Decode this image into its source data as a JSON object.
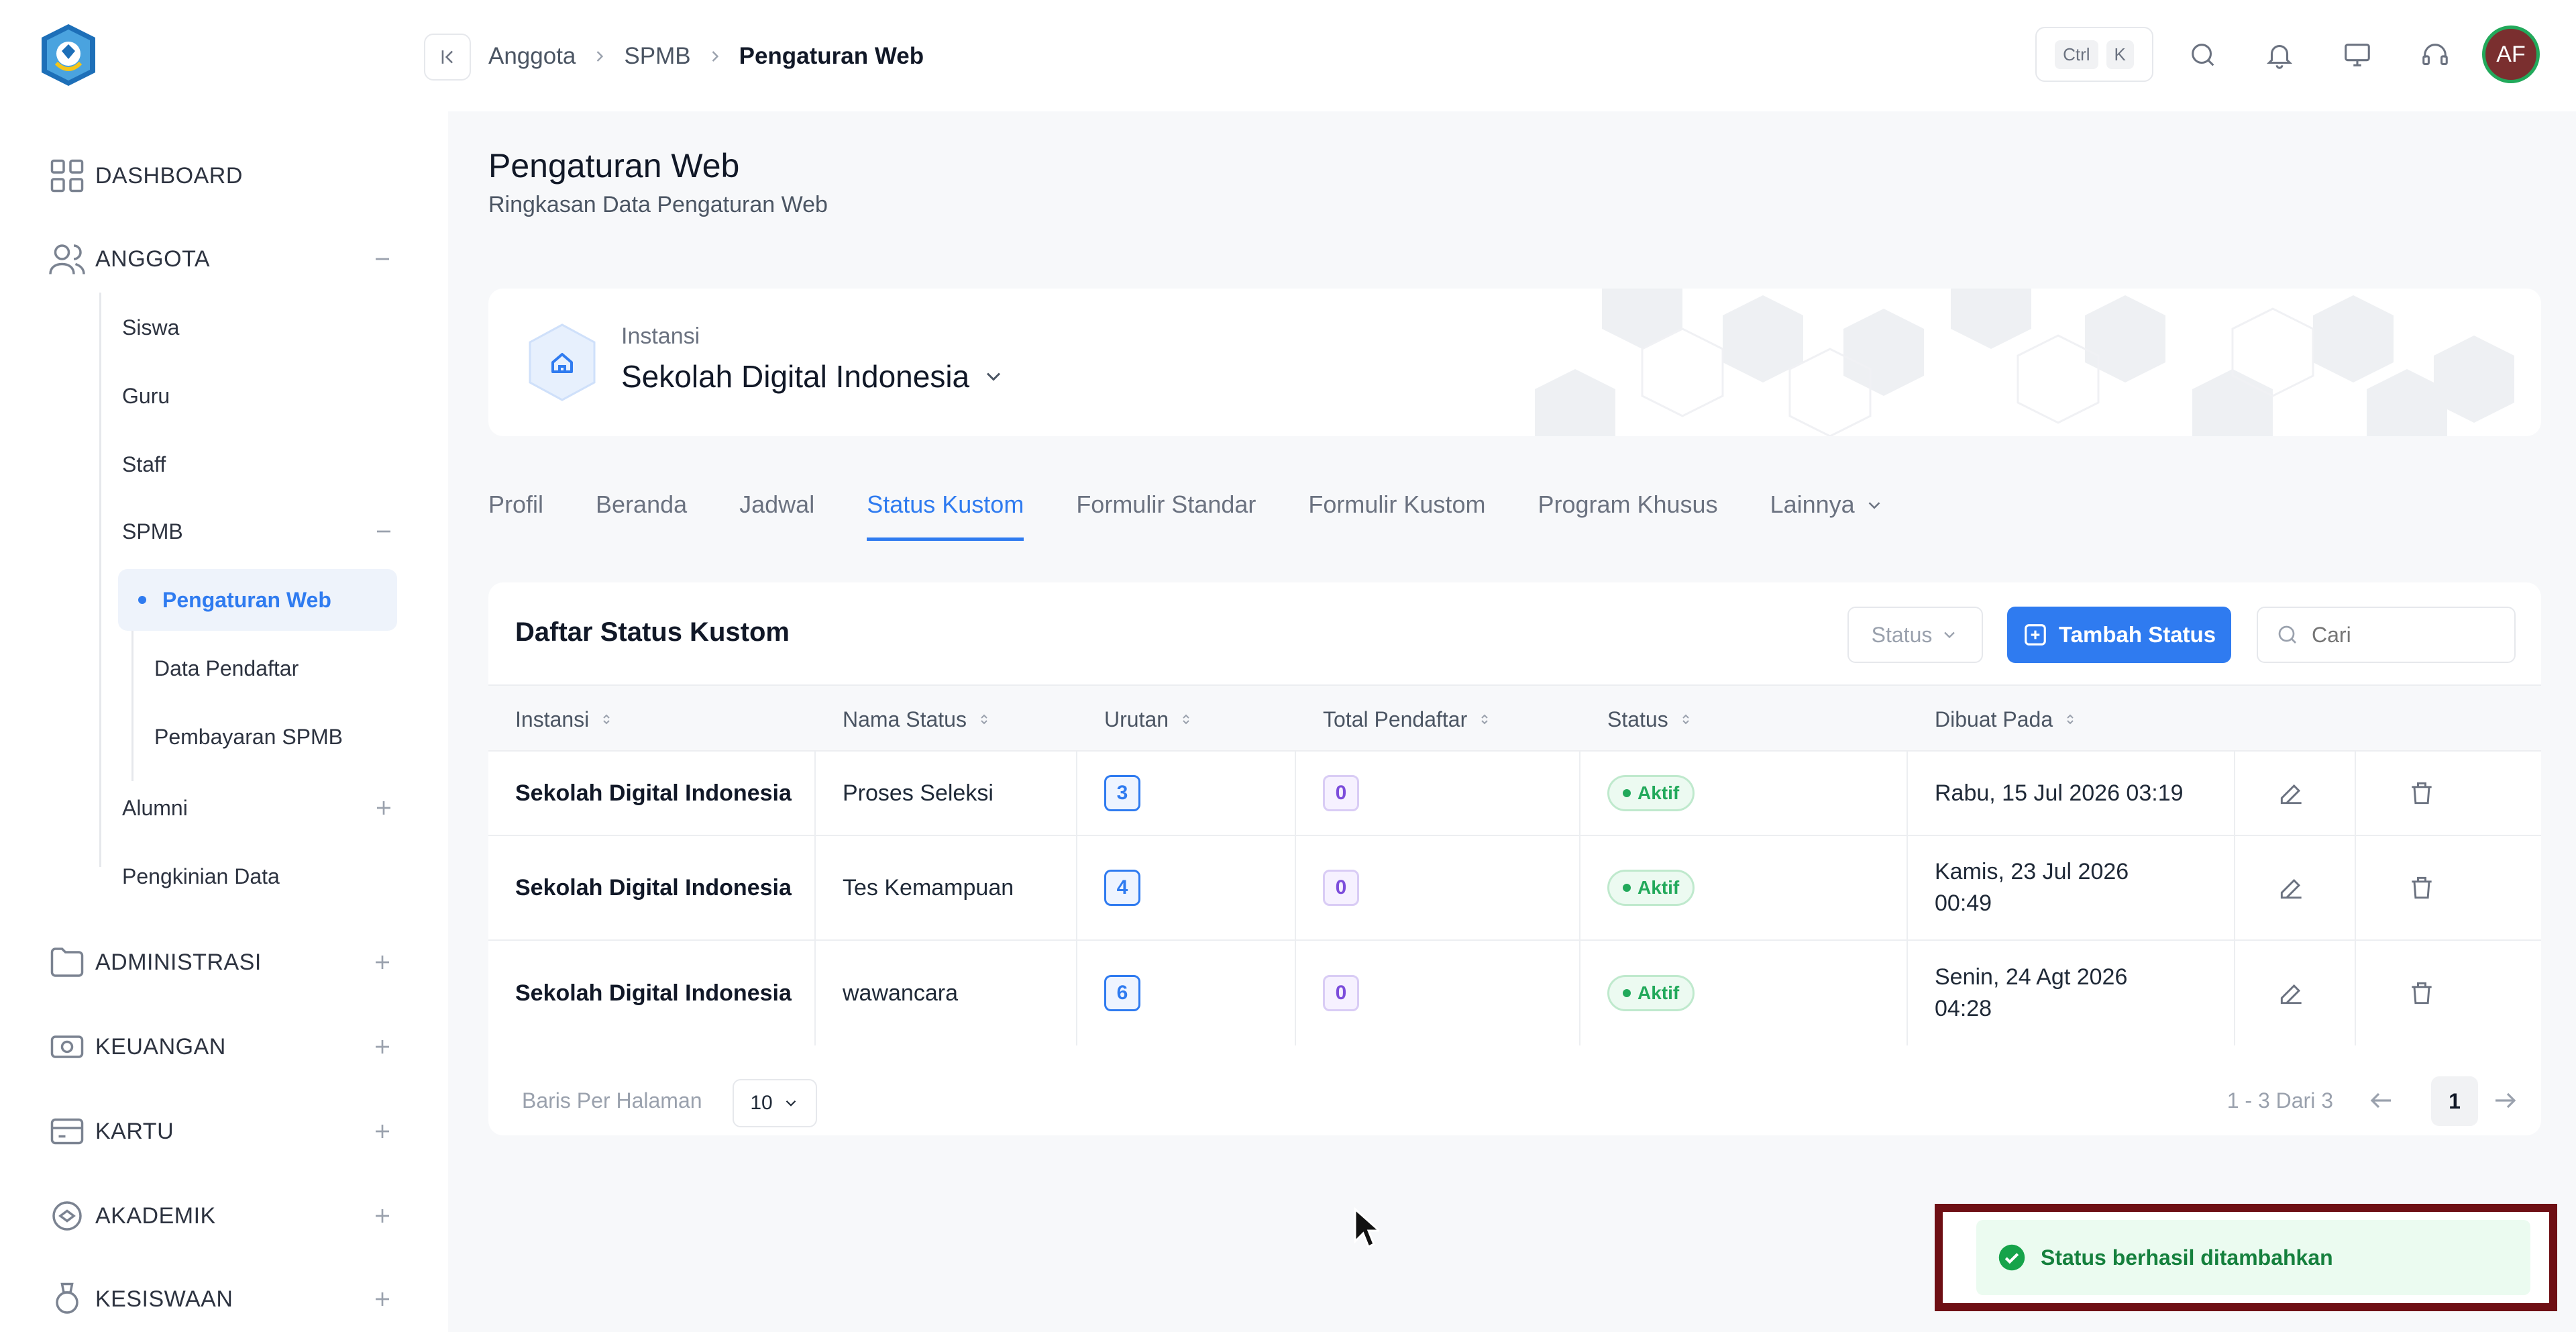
{
  "sidebar": {
    "groups": {
      "dashboard": "DASHBOARD",
      "anggota": "ANGGOTA",
      "administrasi": "ADMINISTRASI",
      "keuangan": "KEUANGAN",
      "kartu": "KARTU",
      "akademik": "AKADEMIK",
      "kesiswaan": "KESISWAAN"
    },
    "anggota_items": {
      "siswa": "Siswa",
      "guru": "Guru",
      "staff": "Staff",
      "spmb": "SPMB",
      "alumni": "Alumni",
      "pengkinian": "Pengkinian Data"
    },
    "spmb_items": {
      "pengaturan_web": "Pengaturan Web",
      "data_pendaftar": "Data Pendaftar",
      "pembayaran": "Pembayaran SPMB"
    }
  },
  "topbar": {
    "breadcrumb": [
      "Anggota",
      "SPMB",
      "Pengaturan Web"
    ],
    "kbd": [
      "Ctrl",
      "K"
    ],
    "avatar": "AF"
  },
  "page": {
    "title": "Pengaturan Web",
    "subtitle": "Ringkasan Data Pengaturan Web"
  },
  "instansi": {
    "label": "Instansi",
    "name": "Sekolah Digital Indonesia"
  },
  "tabs": [
    "Profil",
    "Beranda",
    "Jadwal",
    "Status Kustom",
    "Formulir Standar",
    "Formulir Kustom",
    "Program Khusus",
    "Lainnya"
  ],
  "active_tab": "Status Kustom",
  "table": {
    "title": "Daftar Status Kustom",
    "status_filter": "Status",
    "add_button": "Tambah Status",
    "search_placeholder": "Cari",
    "columns": [
      "Instansi",
      "Nama Status",
      "Urutan",
      "Total Pendaftar",
      "Status",
      "Dibuat Pada"
    ],
    "rows": [
      {
        "instansi": "Sekolah Digital Indonesia",
        "nama": "Proses Seleksi",
        "urutan": "3",
        "total": "0",
        "status": "Aktif",
        "dibuat_1": "Rabu, 15 Jul 2026 03:19",
        "dibuat_2": ""
      },
      {
        "instansi": "Sekolah Digital Indonesia",
        "nama": "Tes Kemampuan",
        "urutan": "4",
        "total": "0",
        "status": "Aktif",
        "dibuat_1": "Kamis, 23 Jul 2026",
        "dibuat_2": "00:49"
      },
      {
        "instansi": "Sekolah Digital Indonesia",
        "nama": "wawancara",
        "urutan": "6",
        "total": "0",
        "status": "Aktif",
        "dibuat_1": "Senin, 24 Agt 2026",
        "dibuat_2": "04:28"
      }
    ],
    "rows_per_page_label": "Baris Per Halaman",
    "rows_per_page": "10",
    "range": "1 - 3 Dari 3",
    "current_page": "1"
  },
  "toast": {
    "message": "Status berhasil ditambahkan"
  },
  "colors": {
    "accent": "#2f7bf0",
    "success": "#22a95b",
    "toast_border": "#6e0f14"
  }
}
